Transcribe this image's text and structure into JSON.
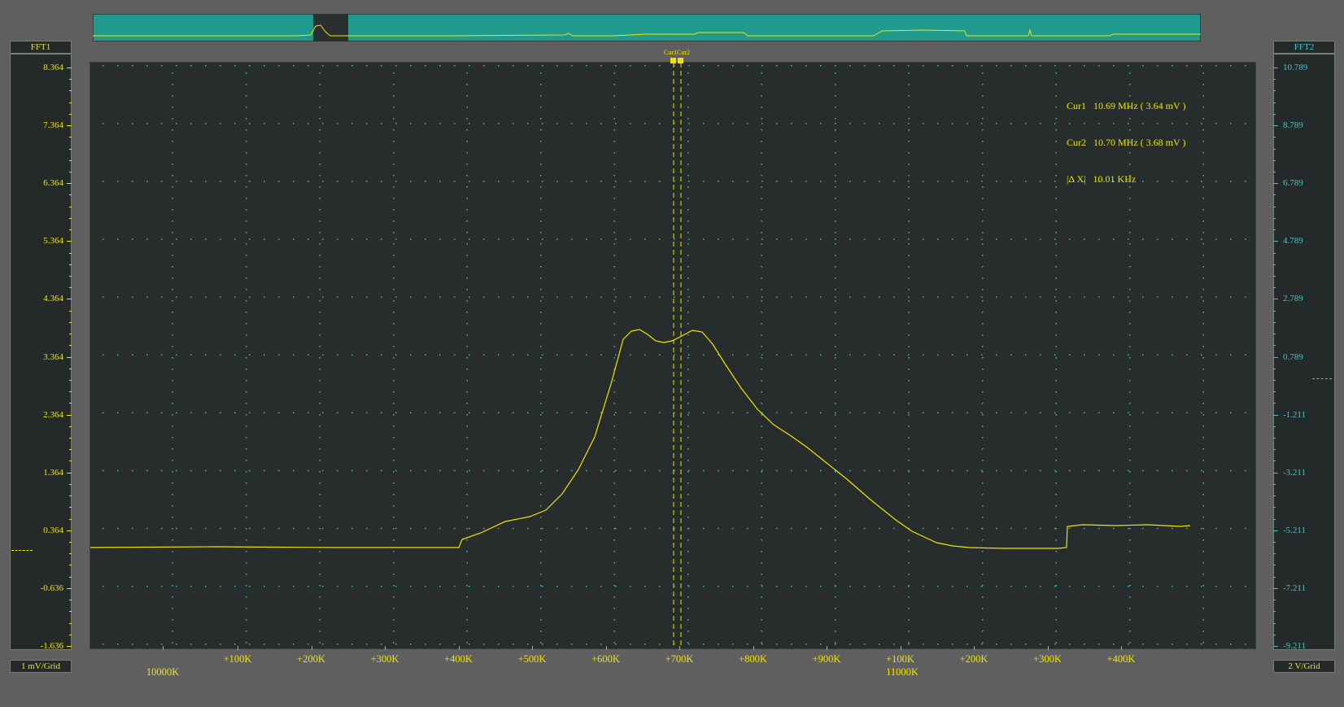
{
  "left_scale": {
    "title": "FFT1",
    "ticks": [
      "8.364",
      "7.364",
      "6.364",
      "5.364",
      "4.364",
      "3.364",
      "2.364",
      "1.364",
      "0.364",
      "-0.636",
      "-1.636"
    ],
    "unit": "1 mV/Grid"
  },
  "right_scale": {
    "title": "FFT2",
    "ticks": [
      "10.789",
      "8.789",
      "6.789",
      "4.789",
      "2.789",
      "0.789",
      "-1.211",
      "-3.211",
      "-5.211",
      "-7.211",
      "-9.211"
    ],
    "unit": "2 V/Grid"
  },
  "x_axis": {
    "ticks": [
      "+100K",
      "+200K",
      "+300K",
      "+400K",
      "+500K",
      "+600K",
      "+700K",
      "+800K",
      "+900K",
      "+100K",
      "+200K",
      "+300K",
      "+400K"
    ],
    "base_labels": [
      "10000K",
      "11000K"
    ]
  },
  "cursors": {
    "tag": "Cur1Cur2",
    "readout": {
      "cur1_name": "Cur1",
      "cur1_value": "10.69 MHz ( 3.64 mV )",
      "cur2_name": "Cur2",
      "cur2_value": "10.70 MHz ( 3.68 mV )",
      "delta_name": "|Δ X|",
      "delta_value": "10.01 KHz"
    }
  },
  "colors": {
    "background": "#5f5f5f",
    "plot_bg": "#272d2d",
    "trace": "#f2e400",
    "grid": "#3fbfa5",
    "overview": "#1f9a8d",
    "right_scale": "#43c6c6"
  }
}
